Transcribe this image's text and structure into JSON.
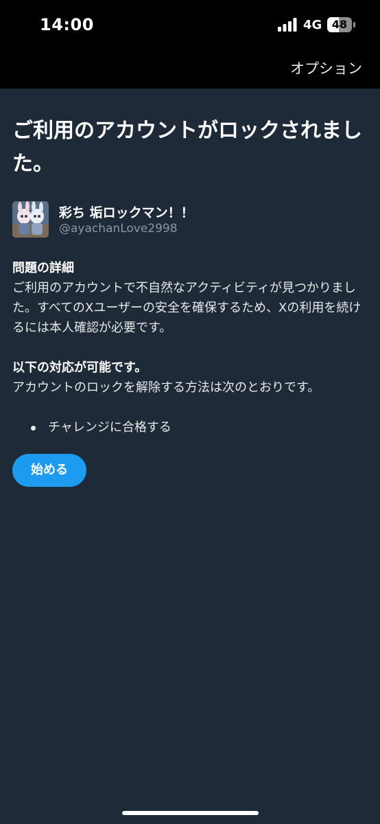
{
  "status_bar": {
    "time": "14:00",
    "network": "4G",
    "battery_level": "48",
    "battery_fraction": 0.48,
    "signal_icon": "signal-bars-icon",
    "battery_icon": "battery-icon"
  },
  "nav": {
    "options_label": "オプション"
  },
  "main": {
    "title": "ご利用のアカウントがロックされました。",
    "account": {
      "display_name": "彩ち 垢ロックマン！！",
      "handle": "@ayachanLove2998"
    },
    "details_heading": "問題の詳細",
    "details_text": "ご利用のアカウントで不自然なアクティビティが見つかりました。すべてのXユーザーの安全を確保するため、Xの利用を続けるには本人確認が必要です。",
    "actions_heading": "以下の対応が可能です。",
    "actions_text": "アカウントのロックを解除する方法は次のとおりです。",
    "options": [
      "チャレンジに合格する"
    ],
    "start_button_label": "始める"
  },
  "colors": {
    "background": "#1e2a37",
    "header": "#000000",
    "accent": "#1d9bf0",
    "secondary_text": "#8b98a5"
  }
}
